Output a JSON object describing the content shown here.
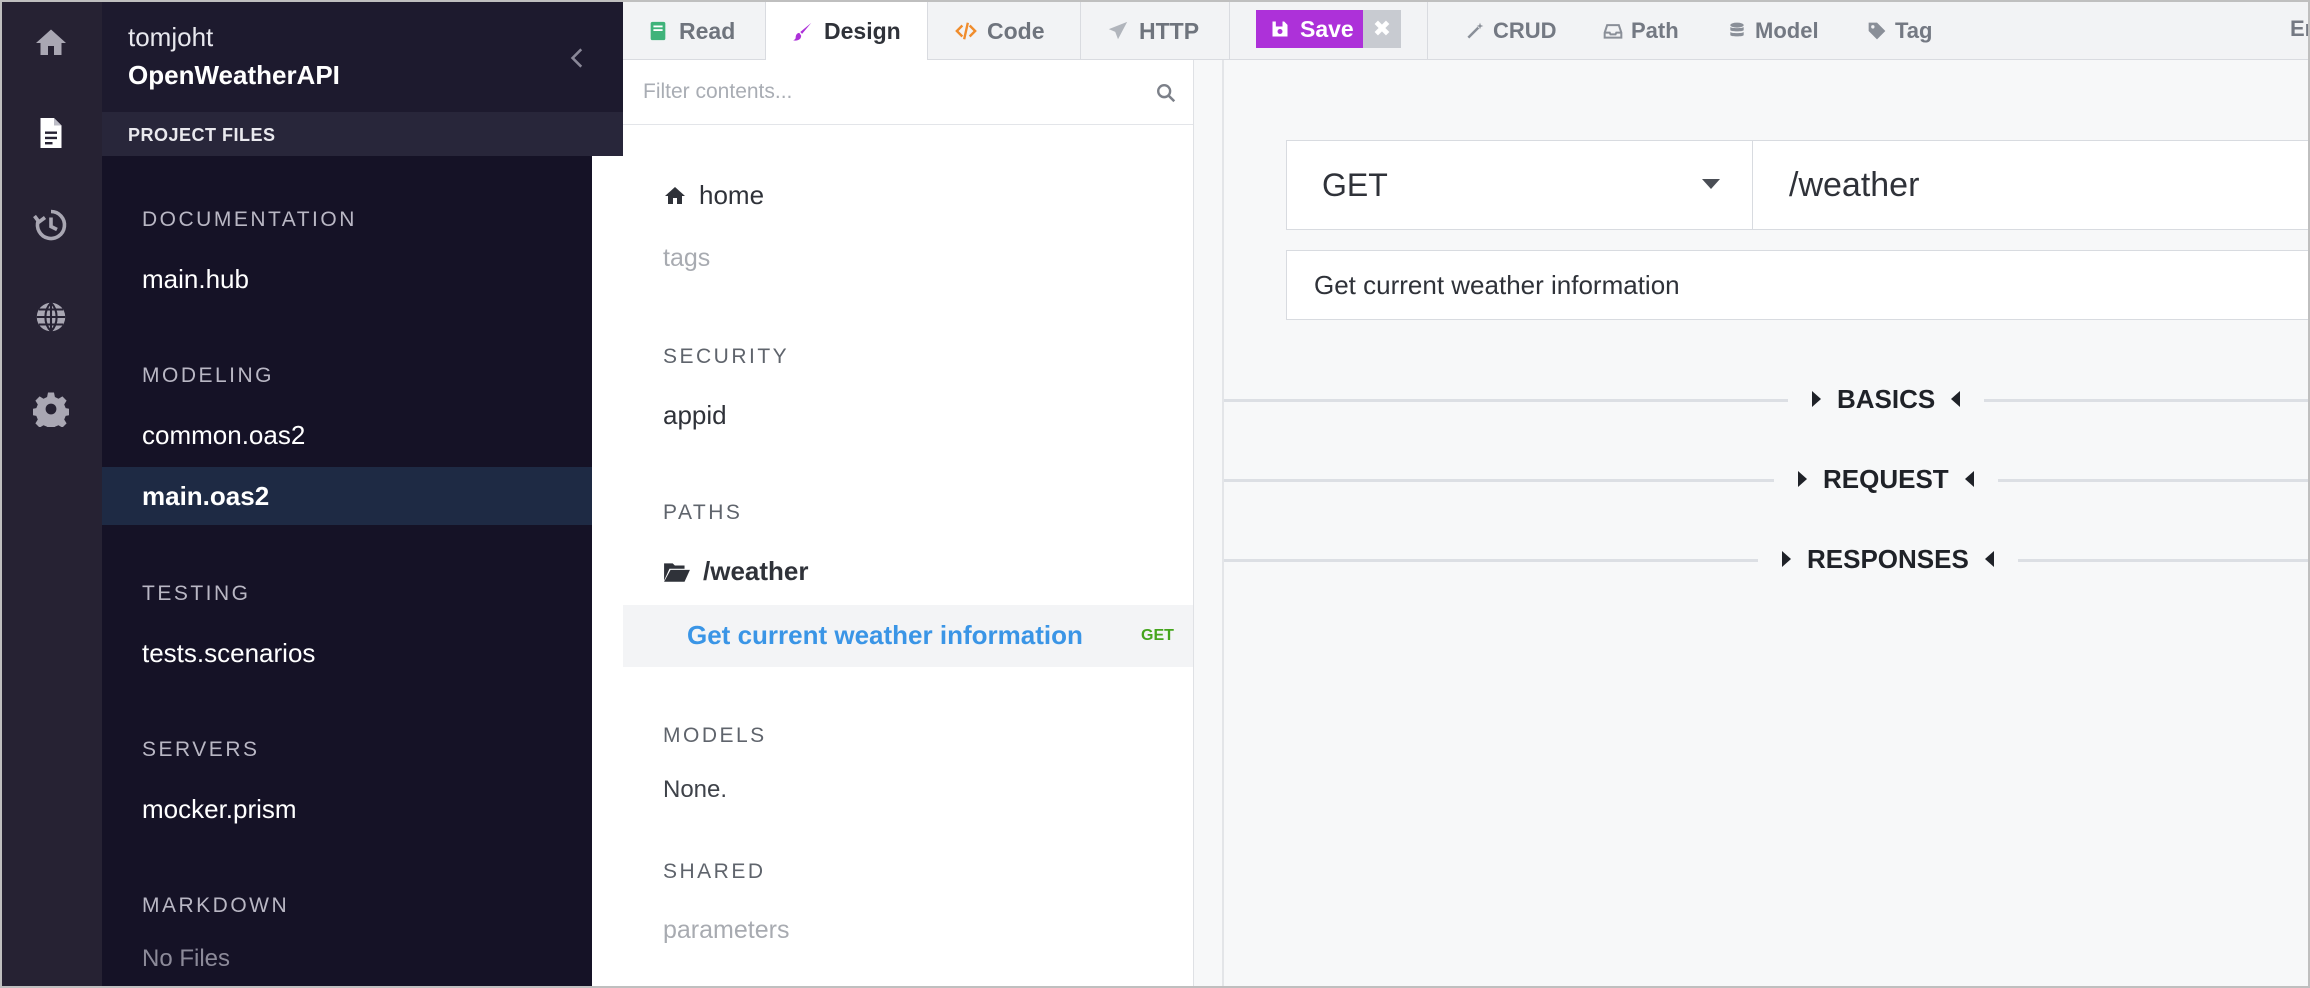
{
  "app": {
    "owner": "tomjoht",
    "project_name": "OpenWeatherAPI"
  },
  "rail": {
    "items": [
      "home-icon",
      "file-icon",
      "history-icon",
      "globe-icon",
      "gear-icon"
    ],
    "active": "file-icon"
  },
  "sidebar": {
    "header": "PROJECT FILES",
    "sections": [
      {
        "title": "DOCUMENTATION",
        "files": [
          "main.hub"
        ]
      },
      {
        "title": "MODELING",
        "files": [
          "common.oas2",
          "main.oas2"
        ]
      },
      {
        "title": "TESTING",
        "files": [
          "tests.scenarios"
        ]
      },
      {
        "title": "SERVERS",
        "files": [
          "mocker.prism"
        ]
      },
      {
        "title": "MARKDOWN",
        "files": [
          "No Files"
        ]
      }
    ],
    "active_file": "main.oas2"
  },
  "tabs": {
    "read": "Read",
    "design": "Design",
    "code": "Code",
    "http": "HTTP",
    "save": "Save",
    "active": "Design"
  },
  "tools": {
    "crud": "CRUD",
    "path": "Path",
    "model": "Model",
    "tag": "Tag",
    "cut_off": "Er"
  },
  "contents": {
    "filter_placeholder": "Filter contents...",
    "home": "home",
    "tags": "tags",
    "security_title": "SECURITY",
    "security_item": "appid",
    "paths_title": "PATHS",
    "path": "/weather",
    "operation": {
      "label": "Get current weather information",
      "method": "GET"
    },
    "models_title": "MODELS",
    "models_empty": "None.",
    "shared_title": "SHARED",
    "shared_item": "parameters"
  },
  "editor": {
    "method": "GET",
    "path": "/weather",
    "summary": "Get current weather information",
    "sections": [
      "BASICS",
      "REQUEST",
      "RESPONSES"
    ]
  },
  "colors": {
    "rail_bg": "#262233",
    "sidebar_bg": "#151226",
    "active_file_bg": "#1e2a44",
    "save_button": "#ad31d9",
    "link_blue": "#3a95e6",
    "get_green": "#45a51d",
    "code_orange": "#f08c2c",
    "read_green": "#3fb37a"
  }
}
